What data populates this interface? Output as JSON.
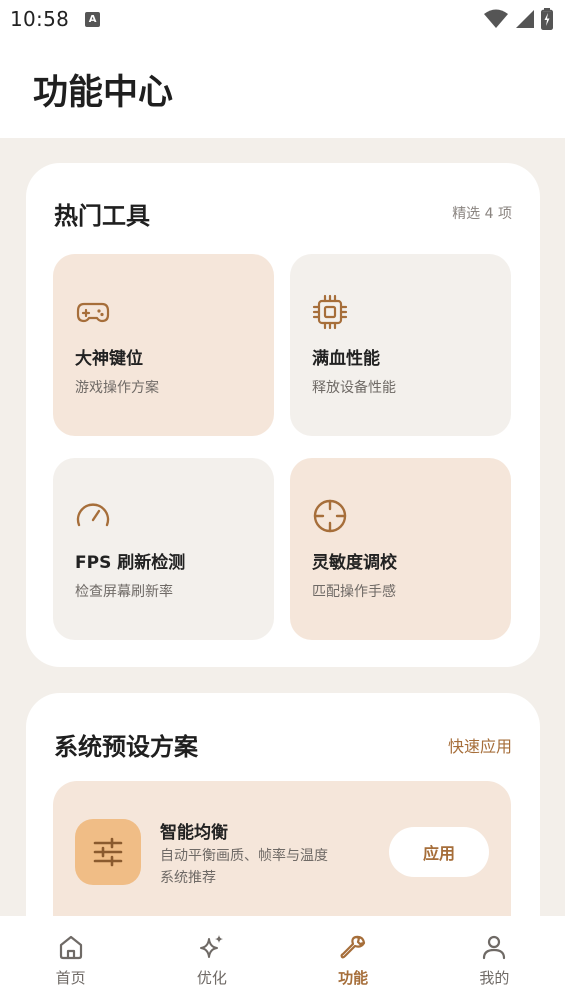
{
  "status_bar": {
    "time": "10:58",
    "notification_badge": "A",
    "icons": [
      "wifi-icon",
      "signal-icon",
      "battery-charging-icon"
    ]
  },
  "header": {
    "title": "功能中心"
  },
  "hot_tools": {
    "title": "热门工具",
    "meta": "精选 4 项",
    "items": [
      {
        "name": "大神键位",
        "desc": "游戏操作方案",
        "icon": "gamepad-icon",
        "style": "warm"
      },
      {
        "name": "满血性能",
        "desc": "释放设备性能",
        "icon": "chip-icon",
        "style": "neutral"
      },
      {
        "name": "FPS 刷新检测",
        "desc": "检查屏幕刷新率",
        "icon": "gauge-icon",
        "style": "neutral"
      },
      {
        "name": "灵敏度调校",
        "desc": "匹配操作手感",
        "icon": "crosshair-icon",
        "style": "warm"
      }
    ]
  },
  "presets": {
    "title": "系统预设方案",
    "link": "快速应用",
    "items": [
      {
        "name": "智能均衡",
        "desc": "自动平衡画质、帧率与温度",
        "sub": "系统推荐",
        "button": "应用",
        "icon": "sliders-icon"
      }
    ]
  },
  "bottom_nav": {
    "active": "功能",
    "items": [
      {
        "label": "首页",
        "icon": "home-icon"
      },
      {
        "label": "优化",
        "icon": "sparkle-icon"
      },
      {
        "label": "功能",
        "icon": "wrench-icon"
      },
      {
        "label": "我的",
        "icon": "person-icon"
      }
    ]
  },
  "colors": {
    "accent": "#a66e3a",
    "warm_tile": "#f5e6da",
    "neutral_tile": "#f3f0ec",
    "page_bg": "#f3efea",
    "preset_icon_bg": "#f0bd86"
  }
}
